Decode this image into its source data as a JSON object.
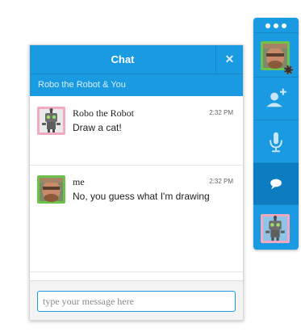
{
  "chat": {
    "title": "Chat",
    "close_icon": "close-icon",
    "subtitle": "Robo the Robot & You",
    "input_placeholder": "type your message here"
  },
  "messages": [
    {
      "sender": "Robo the Robot",
      "time": "2:32 PM",
      "text": "Draw a cat!",
      "avatar": "robot-avatar-icon"
    },
    {
      "sender": "me",
      "time": "2:32 PM",
      "text": "No, you guess what I'm drawing",
      "avatar": "user-avatar-icon"
    }
  ],
  "panel": {
    "icons": [
      "more-dots-icon",
      "user-avatar-icon",
      "settings-gear-icon",
      "add-user-icon",
      "microphone-icon",
      "chat-bubble-icon",
      "robot-avatar-icon"
    ],
    "active": "chat-bubble-icon"
  },
  "colors": {
    "accent": "#1a9ae0",
    "accent_dark": "#0d7cc0",
    "input_border": "#1a9ae0"
  }
}
